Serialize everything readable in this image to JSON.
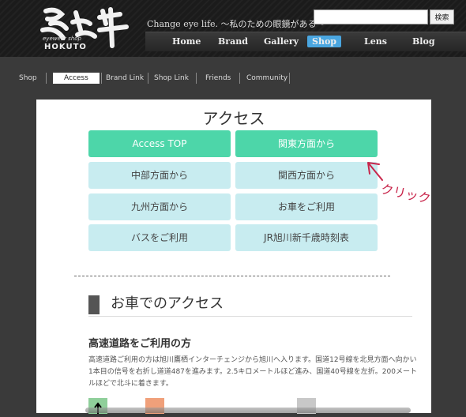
{
  "header": {
    "logo_small": "eyewear shop",
    "logo_name": "HOKUTO",
    "tagline": "Change eye life. ～私のための眼鏡がある～",
    "search_placeholder": "",
    "search_button": "検索"
  },
  "gnav": [
    "Home",
    "Brand",
    "Gallery",
    "Shop",
    "Lens",
    "Blog"
  ],
  "subnav": [
    "Shop",
    "Access",
    "Brand Link",
    "Shop Link",
    "Friends",
    "Community"
  ],
  "content": {
    "title": "アクセス",
    "buttons": [
      "Access TOP",
      "関東方面から",
      "中部方面から",
      "関西方面から",
      "九州方面から",
      "お車をご利用",
      "バスをご利用",
      "JR旭川新千歳時刻表"
    ],
    "section_heading": "お車でのアクセス",
    "sub_title": "高速道路をご利用の方",
    "paragraph": "高速道路ご利用の方は旭川鷹栖インターチェンジから旭川へ入ります。国道12号線を北見方面へ向かい1本目の信号を右折し道道487を進みます。2.5キロメートルほど進み、国道40号線を左折。200メートルほどで北斗に着きます。"
  },
  "annotation": {
    "text": "クリック",
    "color": "#c8264b"
  },
  "colors": {
    "primary": "#4dd6a9",
    "secondary": "#c8ecf0",
    "nav_active": "#4aa6e0"
  }
}
